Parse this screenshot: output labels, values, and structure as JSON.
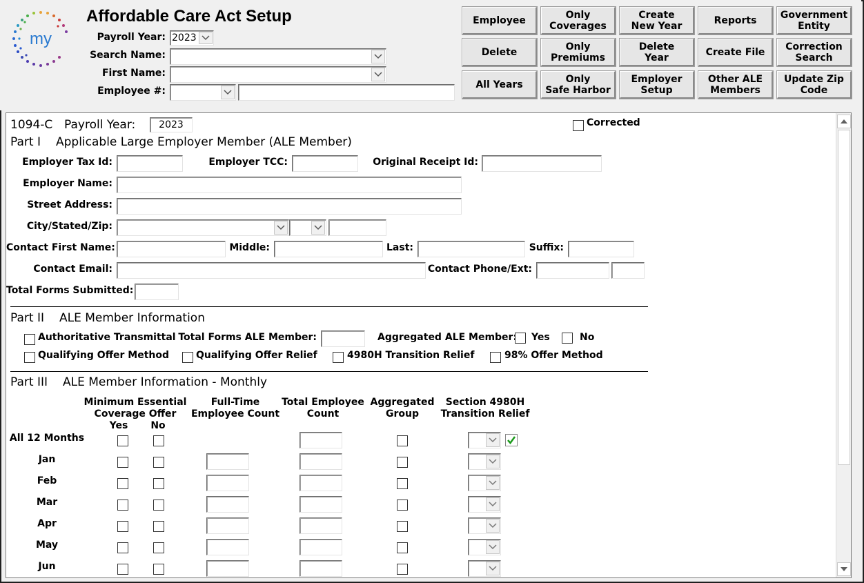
{
  "header": {
    "title": "Affordable Care Act Setup",
    "payroll_year_label": "Payroll Year:",
    "payroll_year_value": "2023",
    "search_name_label": "Search Name:",
    "first_name_label": "First Name:",
    "employee_num_label": "Employee #:",
    "logo_text": "my"
  },
  "toolbar": {
    "employee": "Employee",
    "only_coverages": "Only\nCoverages",
    "create_new_year": "Create\nNew Year",
    "reports": "Reports",
    "government_entity": "Government\nEntity",
    "delete": "Delete",
    "only_premiums": "Only\nPremiums",
    "delete_year": "Delete\nYear",
    "create_file": "Create File",
    "correction_search": "Correction\nSearch",
    "all_years": "All Years",
    "only_safe_harbor": "Only\nSafe Harbor",
    "employer_setup": "Employer\nSetup",
    "other_ale_members": "Other ALE\nMembers",
    "update_zip_code": "Update Zip\nCode"
  },
  "form": {
    "form_id": "1094-C",
    "payroll_year_label": "Payroll Year:",
    "payroll_year_value": "2023",
    "corrected_label": "Corrected",
    "part1": {
      "num": "Part I",
      "title": "Applicable Large Employer Member (ALE Member)",
      "employer_tax_id": "Employer Tax Id:",
      "employer_tcc": "Employer TCC:",
      "original_receipt_id": "Original Receipt Id:",
      "employer_name": "Employer Name:",
      "street_address": "Street Address:",
      "city_state_zip": "City/Stated/Zip:",
      "contact_first_name": "Contact First Name:",
      "middle": "Middle:",
      "last": "Last:",
      "suffix": "Suffix:",
      "contact_email": "Contact Email:",
      "contact_phone_ext": "Contact Phone/Ext:",
      "total_forms_submitted": "Total Forms Submitted:"
    },
    "part2": {
      "num": "Part II",
      "title": "ALE Member Information",
      "authoritative_transmittal": "Authoritative Transmittal",
      "total_forms_ale_member": "Total Forms ALE Member:",
      "aggregated_ale_member": "Aggregated ALE Member:",
      "yes": "Yes",
      "no": "No",
      "qualifying_offer_method": "Qualifying Offer Method",
      "qualifying_offer_relief": "Qualifying Offer Relief",
      "transition_relief_4980h": "4980H Transition Relief",
      "offer_method_98": "98% Offer Method"
    },
    "part3": {
      "num": "Part III",
      "title": "ALE Member Information - Monthly",
      "col_mec": "Minimum Essential\nCoverage Offer",
      "col_yes": "Yes",
      "col_no": "No",
      "col_fulltime": "Full-Time\nEmployee Count",
      "col_total": "Total Employee\nCount",
      "col_aggregated": "Aggregated\nGroup",
      "col_section": "Section 4980H\nTransition Relief",
      "months": [
        "All 12 Months",
        "Jan",
        "Feb",
        "Mar",
        "Apr",
        "May",
        "Jun"
      ]
    }
  }
}
